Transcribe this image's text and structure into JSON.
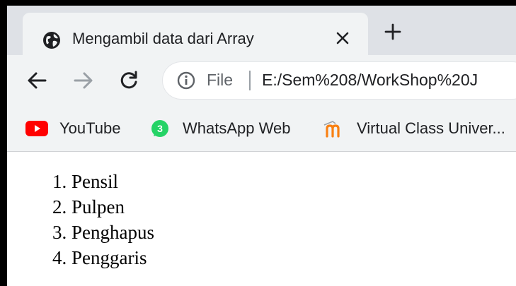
{
  "tab": {
    "title": "Mengambil data dari Array",
    "favicon": "globe-icon",
    "close": "close-icon"
  },
  "new_tab": "plus-icon",
  "toolbar": {
    "back": "back-arrow-icon",
    "forward": "forward-arrow-icon",
    "reload": "reload-icon"
  },
  "omnibox": {
    "info_icon": "info-icon",
    "scheme_label": "File",
    "url": "E:/Sem%208/WorkShop%20J"
  },
  "bookmarks": [
    {
      "label": "YouTube",
      "icon": "youtube-icon"
    },
    {
      "label": "WhatsApp Web",
      "icon": "whatsapp-icon"
    },
    {
      "label": "Virtual Class Univer...",
      "icon": "moodle-icon"
    }
  ],
  "list": [
    {
      "number": "1.",
      "text": "Pensil"
    },
    {
      "number": "2.",
      "text": "Pulpen"
    },
    {
      "number": "3.",
      "text": "Penghapus"
    },
    {
      "number": "4.",
      "text": "Penggaris"
    }
  ],
  "colors": {
    "tabstrip_bg": "#dee1e6",
    "toolbar_bg": "#f1f3f4",
    "youtube_red": "#ff0000",
    "whatsapp_green": "#25d366",
    "moodle_orange": "#f98012"
  }
}
